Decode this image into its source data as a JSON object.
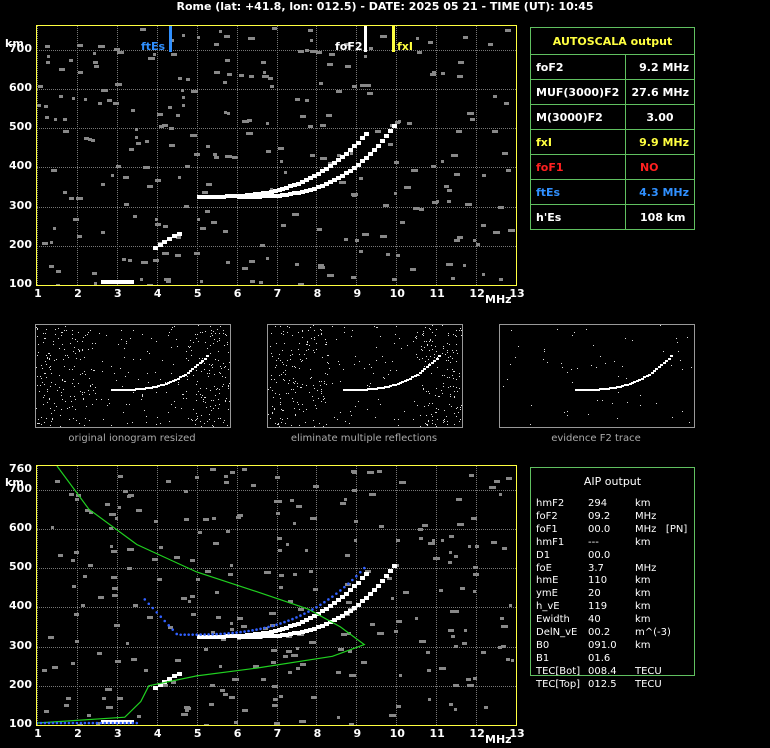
{
  "title": "Rome (lat: +41.8, lon: 012.5) - DATE: 2025 05 21 - TIME (UT): 10:45",
  "colors": {
    "frame": "#ffff40",
    "box": "#60c060",
    "yellow": "#ffff40",
    "red": "#ff2020",
    "blue": "#3090ff",
    "green": "#20d020"
  },
  "axes": {
    "y_unit": "km",
    "x_unit": "MHz",
    "y_ticks": [
      "700",
      "600",
      "500",
      "400",
      "300",
      "200",
      "100"
    ],
    "y_top": "760",
    "x_ticks": [
      "1",
      "2",
      "3",
      "4",
      "5",
      "6",
      "7",
      "8",
      "9",
      "10",
      "11",
      "12",
      "13"
    ]
  },
  "markers": {
    "ftEs": "ftEs",
    "foF2": "foF2",
    "fxI": "fxI"
  },
  "autoscala": {
    "header": "AUTOSCALA output",
    "rows": [
      {
        "name": "foF2",
        "value": "9.2 MHz",
        "color": "#ffffff",
        "vcolor": "#ffffff"
      },
      {
        "name": "MUF(3000)F2",
        "value": "27.6 MHz",
        "color": "#ffffff",
        "vcolor": "#ffffff"
      },
      {
        "name": "M(3000)F2",
        "value": "3.00",
        "color": "#ffffff",
        "vcolor": "#ffffff"
      },
      {
        "name": "fxI",
        "value": "9.9 MHz",
        "color": "#ffff40",
        "vcolor": "#ffff40"
      },
      {
        "name": "foF1",
        "value": "NO",
        "color": "#ff2020",
        "vcolor": "#ff2020"
      },
      {
        "name": "ftEs",
        "value": "4.3 MHz",
        "color": "#3090ff",
        "vcolor": "#3090ff"
      },
      {
        "name": "h'Es",
        "value": "108     km",
        "color": "#ffffff",
        "vcolor": "#ffffff"
      }
    ]
  },
  "thumbs": [
    {
      "caption": "original ionogram resized"
    },
    {
      "caption": "eliminate multiple reflections"
    },
    {
      "caption": "evidence F2 trace"
    }
  ],
  "aip": {
    "header": "AIP output",
    "rows": [
      {
        "name": "hmF2",
        "value": "294",
        "unit": "km"
      },
      {
        "name": "foF2",
        "value": "09.2",
        "unit": "MHz"
      },
      {
        "name": "foF1",
        "value": "00.0",
        "unit": "MHz   [PN]"
      },
      {
        "name": "hmF1",
        "value": "---",
        "unit": "km"
      },
      {
        "name": "D1",
        "value": "00.0",
        "unit": ""
      },
      {
        "name": "foE",
        "value": "3.7",
        "unit": "MHz"
      },
      {
        "name": "hmE",
        "value": "110",
        "unit": "km"
      },
      {
        "name": "ymE",
        "value": "20",
        "unit": "km"
      },
      {
        "name": "h_vE",
        "value": "119",
        "unit": "km"
      },
      {
        "name": "Ewidth",
        "value": "40",
        "unit": "km"
      },
      {
        "name": "DelN_vE",
        "value": "00.2",
        "unit": "m^(-3)"
      },
      {
        "name": "B0",
        "value": "091.0",
        "unit": "km"
      },
      {
        "name": "B1",
        "value": "01.6",
        "unit": ""
      },
      {
        "name": "TEC[Bot]",
        "value": "008.4",
        "unit": "TECU"
      },
      {
        "name": "TEC[Top]",
        "value": "012.5",
        "unit": "TECU"
      }
    ]
  }
}
